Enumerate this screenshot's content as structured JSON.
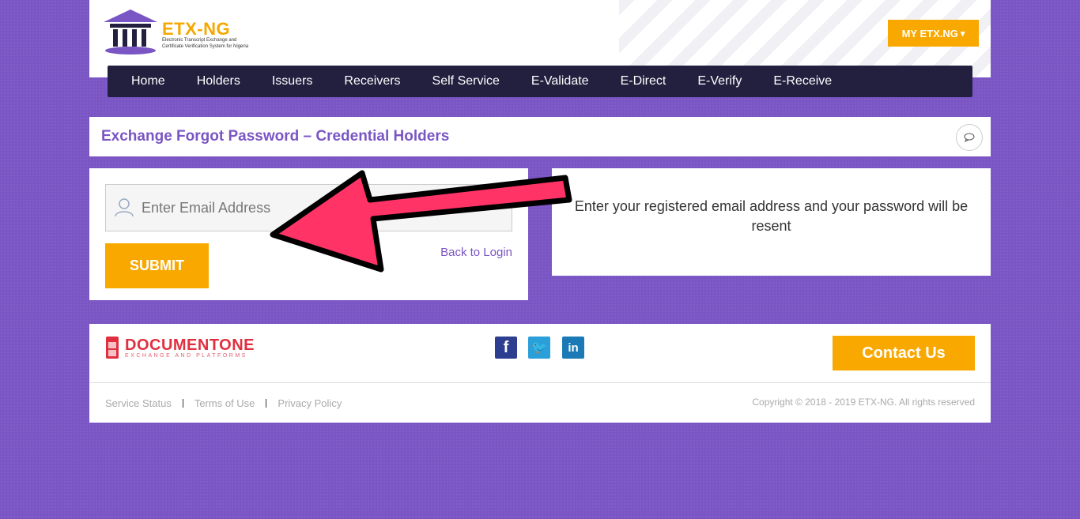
{
  "header": {
    "logo_text": "ETX-NG",
    "logo_subtitle_line1": "Electronic Transcript Exchange and",
    "logo_subtitle_line2": "Certificate Verification System for Nigeria",
    "my_account_label": "MY ETX.NG",
    "my_account_caret": "▾"
  },
  "nav": {
    "items": [
      "Home",
      "Holders",
      "Issuers",
      "Receivers",
      "Self Service",
      "E-Validate",
      "E-Direct",
      "E-Verify",
      "E-Receive"
    ]
  },
  "page": {
    "title": "Exchange Forgot Password – Credential Holders"
  },
  "form": {
    "email_placeholder": "Enter Email Address",
    "email_value": "",
    "submit_label": "SUBMIT",
    "back_link": "Back to Login"
  },
  "info": {
    "text": "Enter your registered email address and your password will be resent"
  },
  "footer": {
    "partner_name": "DOCUMENTONE",
    "partner_tagline": "EXCHANGE AND PLATFORMS",
    "social": {
      "facebook": "f",
      "twitter": "🐦",
      "linkedin": "in"
    },
    "contact_label": "Contact Us",
    "links": [
      "Service Status",
      "Terms of Use",
      "Privacy Policy"
    ],
    "copyright": "Copyright © 2018 - 2019 ETX-NG. All rights reserved"
  },
  "colors": {
    "accent": "#7a55c4",
    "button": "#f9a800",
    "nav_bg": "#231f3f",
    "annotation_arrow": "#ff3366"
  },
  "icons": {
    "logo": "university-building-icon",
    "email": "user-icon",
    "comment": "comment-icon"
  }
}
